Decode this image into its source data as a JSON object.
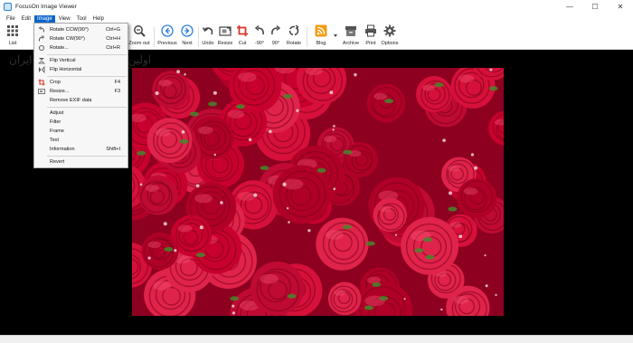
{
  "window": {
    "title": "FocusOn Image Viewer",
    "minimize": "—",
    "maximize": "☐",
    "close": "✕"
  },
  "menu": [
    "File",
    "Edit",
    "Image",
    "View",
    "Tool",
    "Help"
  ],
  "active_menu": "Image",
  "toolbar": {
    "list": "List",
    "zoom_out": "Zoom out",
    "previous": "Previous",
    "next": "Next",
    "undo": "Undo",
    "resize": "Resize",
    "cut": "Cut",
    "rot_ccw": "-90°",
    "rot_cw": "90°",
    "rotate": "Rotate",
    "blog": "Blog",
    "archive": "Archive",
    "print": "Print",
    "options": "Options"
  },
  "image_menu": {
    "rotate_ccw": {
      "label": "Rotate CCW(90°)",
      "shortcut": "Ctrl+G"
    },
    "rotate_cw": {
      "label": "Rotate CW(90°)",
      "shortcut": "Ctrl+H"
    },
    "rotate": {
      "label": "Rotate...",
      "shortcut": "Ctrl+R"
    },
    "flip_vertical": {
      "label": "Flip Vertical"
    },
    "flip_horizontal": {
      "label": "Flip Horizontal"
    },
    "crop": {
      "label": "Crop",
      "shortcut": "F4"
    },
    "resize": {
      "label": "Resize...",
      "shortcut": "F3"
    },
    "remove_exif": {
      "label": "Remove EXIF data"
    },
    "adjust": {
      "label": "Adjust"
    },
    "filter": {
      "label": "Filter"
    },
    "frame": {
      "label": "Frame"
    },
    "text": {
      "label": "Text"
    },
    "information": {
      "label": "Information",
      "shortcut": "Shift+I"
    },
    "revert": {
      "label": "Revert"
    }
  },
  "watermark_text": "اولین دانشگاه نرم افزاری ایران",
  "image": {
    "subject": "red roses"
  },
  "colors": {
    "menu_highlight": "#0a64c8",
    "item_highlight": "#d3e4f6",
    "accent_blue": "#2f7fd8",
    "blog_orange": "#f39c12",
    "crop_red": "#d9342b",
    "background": "#000000"
  }
}
